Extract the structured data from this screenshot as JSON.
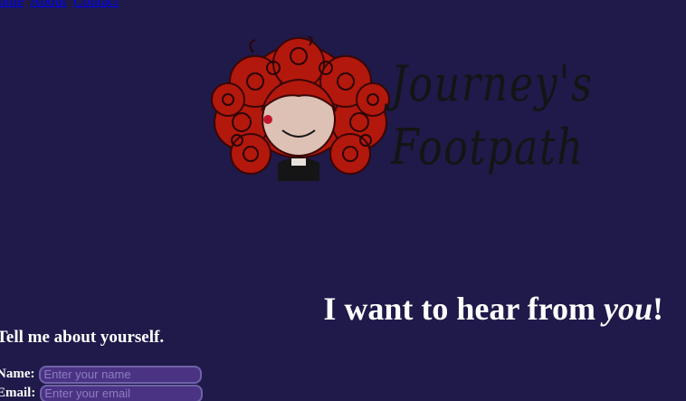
{
  "nav": {
    "links": [
      "Home",
      "About",
      "Contact"
    ]
  },
  "logo": {
    "line1": "Journey's",
    "line2": "Footpath"
  },
  "headline": {
    "before": "I want to hear from ",
    "emphasis": "you",
    "after": "!"
  },
  "form": {
    "intro": "Tell me about yourself.",
    "name_label": "Name:",
    "name_placeholder": "Enter your name",
    "email_label": "Email:",
    "email_placeholder": "Enter your email"
  },
  "colors": {
    "background": "#1f1a4a",
    "link": "#0000ee",
    "input_bg": "#4b3384",
    "hair": "#b3180d"
  }
}
